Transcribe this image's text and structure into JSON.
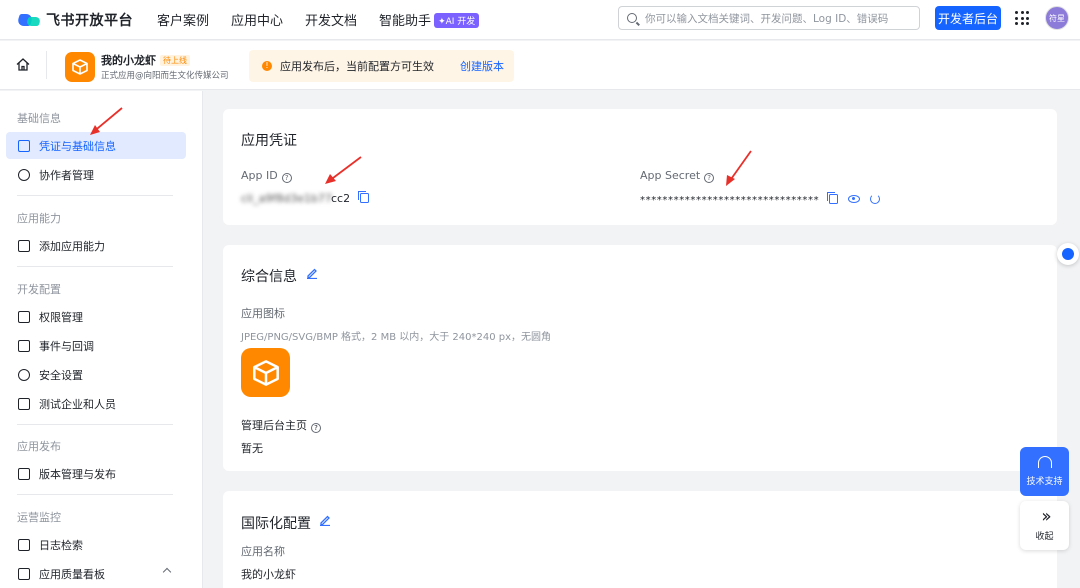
{
  "topnav": {
    "brand": "飞书开放平台",
    "items": [
      "客户案例",
      "应用中心",
      "开发文档",
      "智能助手"
    ],
    "ai_badge": "✦AI 开发",
    "search_placeholder": "你可以输入文档关键词、开发问题、Log ID、错误码",
    "dev_console": "开发者后台",
    "avatar_text": "符星"
  },
  "appbar": {
    "app_name": "我的小龙虾",
    "app_tag": "待上线",
    "app_subtitle": "正式应用@向阳而生文化传媒公司",
    "notice_text": "应用发布后，当前配置方可生效",
    "notice_link": "创建版本"
  },
  "sidebar": {
    "sections": [
      {
        "title": "基础信息",
        "items": [
          "凭证与基础信息",
          "协作者管理"
        ]
      },
      {
        "title": "应用能力",
        "items": [
          "添加应用能力"
        ]
      },
      {
        "title": "开发配置",
        "items": [
          "权限管理",
          "事件与回调",
          "安全设置",
          "测试企业和人员"
        ]
      },
      {
        "title": "应用发布",
        "items": [
          "版本管理与发布"
        ]
      },
      {
        "title": "运营监控",
        "items": [
          "日志检索",
          "应用质量看板"
        ]
      }
    ],
    "active_item": "凭证与基础信息"
  },
  "credentials": {
    "title": "应用凭证",
    "app_id_label": "App ID",
    "app_id_value": "cli_a9f8d3e1b77cc2",
    "app_id_visible_suffix": "cc2",
    "app_secret_label": "App Secret",
    "app_secret_value": "********************************"
  },
  "general": {
    "title": "综合信息",
    "icon_label": "应用图标",
    "icon_hint": "JPEG/PNG/SVG/BMP 格式，2 MB 以内，大于 240*240 px，无圆角",
    "admin_home_label": "管理后台主页",
    "admin_home_value": "暂无"
  },
  "i18n": {
    "title": "国际化配置",
    "app_name_label": "应用名称",
    "app_name_value": "我的小龙虾"
  },
  "floating": {
    "support": "技术支持",
    "collapse": "收起"
  },
  "colors": {
    "primary": "#1664ff",
    "app_icon": "#ff8800",
    "annotation_arrow": "#e8302a"
  }
}
